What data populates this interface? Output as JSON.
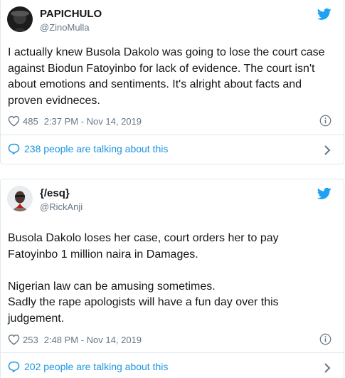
{
  "colors": {
    "accent": "#1b95e0",
    "twitter_blue": "#1da1f2",
    "text": "#14171a",
    "muted": "#657786",
    "border": "#e1e8ed"
  },
  "tweets": [
    {
      "display_name": "PAPICHULO",
      "handle": "@ZinoMulla",
      "text": "I actually knew Busola Dakolo was going to lose the court case against Biodun Fatoyinbo for lack of evidence. The court isn't about emotions and sentiments. It's alright about facts and proven evidneces.",
      "likes": "485",
      "timestamp": "2:37 PM - Nov 14, 2019",
      "conversation": "238 people are talking about this",
      "icons": [
        "heart-icon",
        "info-icon",
        "twitter-logo-icon",
        "comment-bubble-icon",
        "chevron-right-icon"
      ]
    },
    {
      "display_name": "{/esq}",
      "handle": "@RickAnji",
      "text": "Busola Dakolo loses her case, court orders her to pay Fatoyinbo 1 million naira in Damages.\n\nNigerian law can be amusing sometimes.\nSadly the rape apologists will have a fun day over this judgement.",
      "likes": "253",
      "timestamp": "2:48 PM - Nov 14, 2019",
      "conversation": "202 people are talking about this",
      "icons": [
        "heart-icon",
        "info-icon",
        "twitter-logo-icon",
        "comment-bubble-icon",
        "chevron-right-icon"
      ]
    }
  ]
}
